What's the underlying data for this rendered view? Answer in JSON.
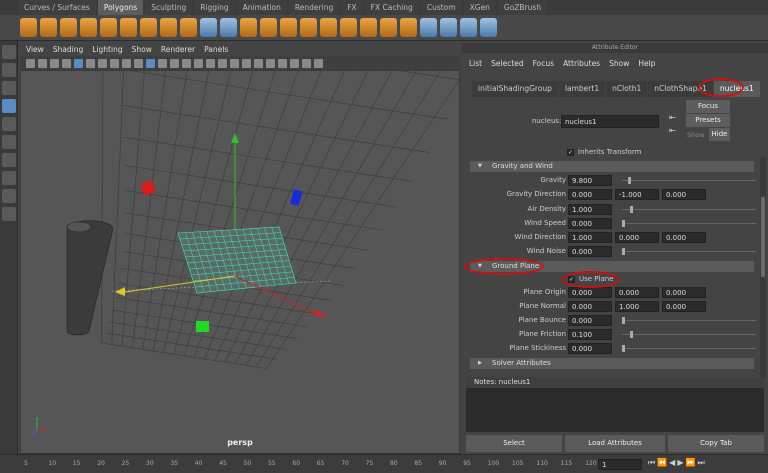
{
  "shelf_tabs": [
    "Curves / Surfaces",
    "Polygons",
    "Sculpting",
    "Rigging",
    "Animation",
    "Rendering",
    "FX",
    "FX Caching",
    "Custom",
    "XGen",
    "GoZBrush"
  ],
  "active_shelf_tab": "Polygons",
  "viewport": {
    "menu": [
      "View",
      "Shading",
      "Lighting",
      "Show",
      "Renderer",
      "Panels"
    ],
    "camera": "persp"
  },
  "attribute_editor": {
    "title": "Attribute Editor",
    "menu": [
      "List",
      "Selected",
      "Focus",
      "Attributes",
      "Show",
      "Help"
    ],
    "tabs": [
      "initialShadingGroup",
      "lambert1",
      "nCloth1",
      "nClothShape1",
      "nucleus1"
    ],
    "active_tab": "nucleus1",
    "node_label": "nucleus:",
    "node_value": "nucleus1",
    "focus_btn": "Focus",
    "presets_btn": "Presets",
    "show_lbl": "Show",
    "hide_btn": "Hide",
    "inherits_transform": "Inherits Transform",
    "gravity_section": "Gravity and Wind",
    "gravity": {
      "label": "Gravity",
      "value": "9.800"
    },
    "gravity_dir": {
      "label": "Gravity Direction",
      "v": [
        "0.000",
        "-1.000",
        "0.000"
      ]
    },
    "air_density": {
      "label": "Air Density",
      "value": "1.000"
    },
    "wind_speed": {
      "label": "Wind Speed",
      "value": "0.000"
    },
    "wind_dir": {
      "label": "Wind Direction",
      "v": [
        "1.000",
        "0.000",
        "0.000"
      ]
    },
    "wind_noise": {
      "label": "Wind Noise",
      "value": "0.000"
    },
    "ground_section": "Ground Plane",
    "use_plane": "Use Plane",
    "plane_origin": {
      "label": "Plane Origin",
      "v": [
        "0.000",
        "0.000",
        "0.000"
      ]
    },
    "plane_normal": {
      "label": "Plane Normal",
      "v": [
        "0.000",
        "1.000",
        "0.000"
      ]
    },
    "plane_bounce": {
      "label": "Plane Bounce",
      "value": "0.000"
    },
    "plane_friction": {
      "label": "Plane Friction",
      "value": "0.100"
    },
    "plane_stickiness": {
      "label": "Plane Stickiness",
      "value": "0.000"
    },
    "solver_section": "Solver Attributes",
    "notes": "Notes: nucleus1",
    "buttons": [
      "Select",
      "Load Attributes",
      "Copy Tab"
    ]
  },
  "timeline": {
    "ticks": [
      "5",
      "10",
      "15",
      "20",
      "25",
      "30",
      "35",
      "40",
      "45",
      "50",
      "55",
      "60",
      "65",
      "70",
      "75",
      "80",
      "85",
      "90",
      "95",
      "100",
      "105",
      "110",
      "115",
      "120"
    ],
    "current_frame": "1"
  }
}
